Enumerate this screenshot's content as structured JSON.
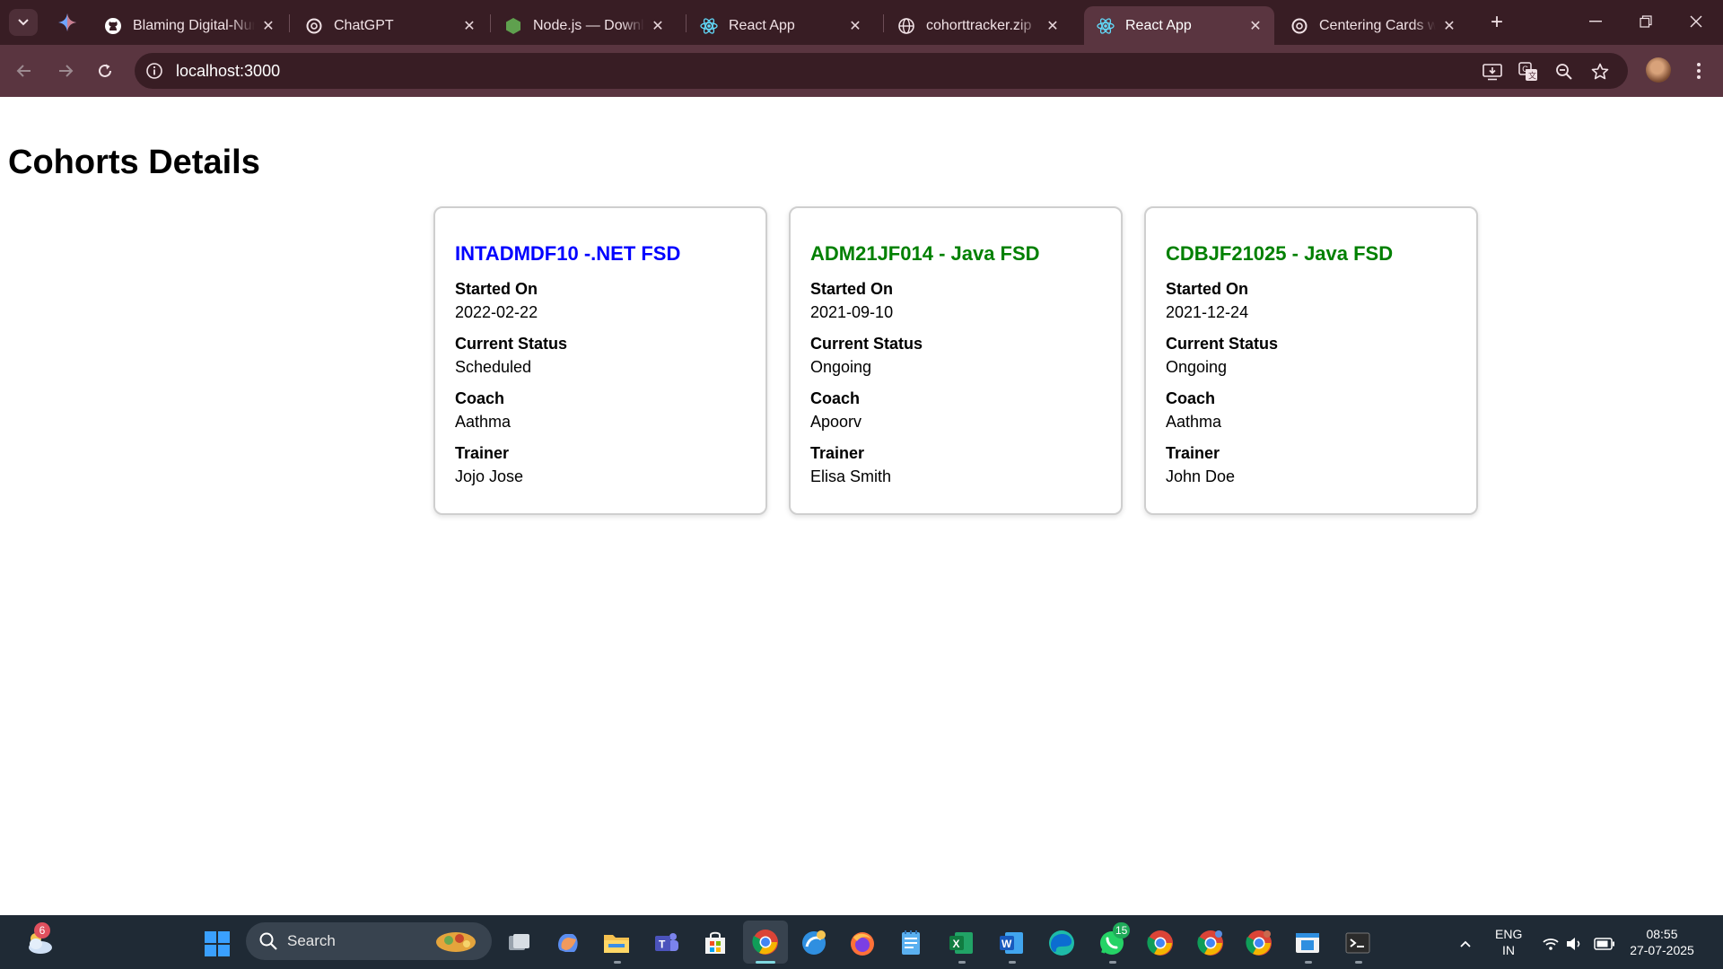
{
  "browser": {
    "tabs": [
      {
        "title": "Blaming Digital-Nurture",
        "icon": "github-icon"
      },
      {
        "title": "ChatGPT",
        "icon": "chatgpt-icon"
      },
      {
        "title": "Node.js — Download",
        "icon": "nodejs-icon"
      },
      {
        "title": "React App",
        "icon": "react-icon"
      },
      {
        "title": "cohorttracker.zip",
        "icon": "globe-icon"
      },
      {
        "title": "React App",
        "icon": "react-icon",
        "active": true
      },
      {
        "title": "Centering Cards with",
        "icon": "chatgpt-icon"
      }
    ],
    "url": "localhost:3000"
  },
  "page": {
    "title": "Cohorts Details",
    "cards": [
      {
        "title": "INTADMDF10 -.NET FSD",
        "title_color": "#0000ff",
        "started_on_label": "Started On",
        "started_on": "2022-02-22",
        "status_label": "Current Status",
        "status": "Scheduled",
        "coach_label": "Coach",
        "coach": "Aathma",
        "trainer_label": "Trainer",
        "trainer": "Jojo Jose"
      },
      {
        "title": "ADM21JF014 - Java FSD",
        "title_color": "#008000",
        "started_on_label": "Started On",
        "started_on": "2021-09-10",
        "status_label": "Current Status",
        "status": "Ongoing",
        "coach_label": "Coach",
        "coach": "Apoorv",
        "trainer_label": "Trainer",
        "trainer": "Elisa Smith"
      },
      {
        "title": "CDBJF21025 - Java FSD",
        "title_color": "#008000",
        "started_on_label": "Started On",
        "started_on": "2021-12-24",
        "status_label": "Current Status",
        "status": "Ongoing",
        "coach_label": "Coach",
        "coach": "Aathma",
        "trainer_label": "Trainer",
        "trainer": "John Doe"
      }
    ]
  },
  "taskbar": {
    "search_label": "Search",
    "weather_badge": "6",
    "whatsapp_badge": "15",
    "language": "ENG",
    "region": "IN",
    "time": "08:55",
    "date": "27-07-2025"
  }
}
